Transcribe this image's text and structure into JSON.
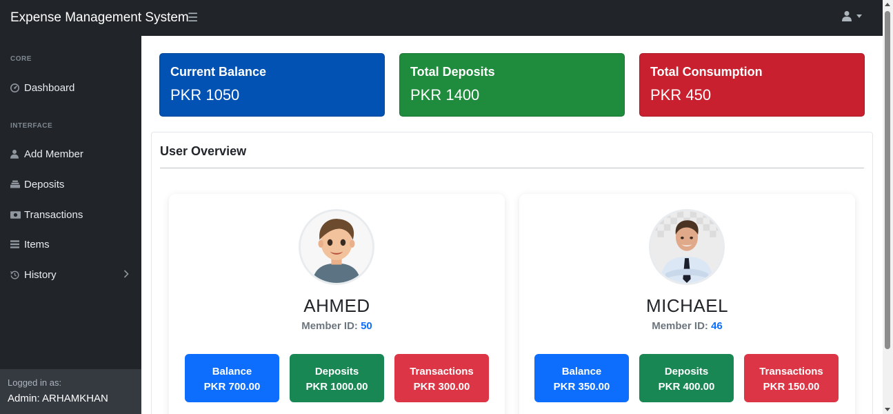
{
  "app": {
    "title": "Expense Management System",
    "menu_icon": "hamburger-icon",
    "user_icon": "user-icon"
  },
  "colors": {
    "primary": "#0152b3",
    "success": "#1f8b3c",
    "danger": "#c8202e",
    "mini_primary": "#0d6efd",
    "mini_success": "#198754",
    "mini_danger": "#dc3545",
    "dark": "#212529"
  },
  "sidebar": {
    "headings": {
      "core": "CORE",
      "interface": "INTERFACE"
    },
    "items": [
      {
        "label": "Dashboard",
        "icon": "dashboard-icon"
      },
      {
        "label": "Add Member",
        "icon": "user-icon"
      },
      {
        "label": "Deposits",
        "icon": "deposit-icon"
      },
      {
        "label": "Transactions",
        "icon": "money-icon"
      },
      {
        "label": "Items",
        "icon": "list-icon"
      },
      {
        "label": "History",
        "icon": "history-icon"
      }
    ],
    "footer": {
      "label": "Logged in as:",
      "user": "Admin: ARHAMKHAN"
    }
  },
  "stats": [
    {
      "title": "Current Balance",
      "value": "PKR 1050"
    },
    {
      "title": "Total Deposits",
      "value": "PKR 1400"
    },
    {
      "title": "Total Consumption",
      "value": "PKR 450"
    }
  ],
  "overview": {
    "title": "User Overview",
    "members": [
      {
        "name": "AHMED",
        "id_label": "Member ID:",
        "id": "50",
        "balance_label": "Balance",
        "balance": "PKR 700.00",
        "deposits_label": "Deposits",
        "deposits": "PKR 1000.00",
        "transactions_label": "Transactions",
        "transactions": "PKR 300.00"
      },
      {
        "name": "MICHAEL",
        "id_label": "Member ID:",
        "id": "46",
        "balance_label": "Balance",
        "balance": "PKR 350.00",
        "deposits_label": "Deposits",
        "deposits": "PKR 400.00",
        "transactions_label": "Transactions",
        "transactions": "PKR 150.00"
      }
    ]
  }
}
